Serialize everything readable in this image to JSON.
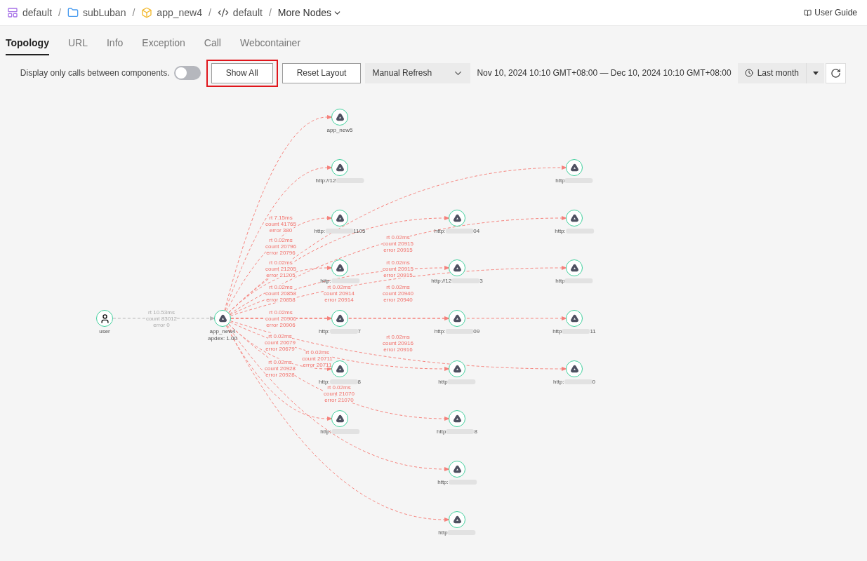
{
  "breadcrumb": {
    "items": [
      {
        "label": "default",
        "kind": "workspace"
      },
      {
        "label": "subLuban",
        "kind": "folder"
      },
      {
        "label": "app_new4",
        "kind": "app"
      },
      {
        "label": "default",
        "kind": "code"
      }
    ],
    "separator": "/",
    "more": "More Nodes"
  },
  "user_guide": "User Guide",
  "tabs": [
    {
      "label": "Topology",
      "selected": true
    },
    {
      "label": "URL",
      "selected": false
    },
    {
      "label": "Info",
      "selected": false
    },
    {
      "label": "Exception",
      "selected": false
    },
    {
      "label": "Call",
      "selected": false
    },
    {
      "label": "Webcontainer",
      "selected": false
    }
  ],
  "toolbar": {
    "toggle_label": "Display only calls between components.",
    "toggle_on": false,
    "show_all": {
      "label": "Show All",
      "highlighted": true
    },
    "reset_layout": "Reset Layout",
    "refresh_mode": "Manual Refresh",
    "time_range": "Nov 10, 2024 10:10 GMT+08:00 — Dec 10, 2024 10:10 GMT+08:00",
    "period": "Last month"
  },
  "graph": {
    "nodes": [
      {
        "kind": "user",
        "name": "user"
      },
      {
        "kind": "service",
        "name": "app_new4",
        "sub": "apdex: 1.00"
      },
      {
        "kind": "service",
        "name": "app_new5"
      },
      {
        "kind": "service",
        "name": "http://12",
        "masked": true
      },
      {
        "kind": "service",
        "name": "http:",
        "masked": true,
        "suffix": "1105"
      },
      {
        "kind": "service",
        "name": "http:",
        "masked": true
      },
      {
        "kind": "service",
        "name": "http:",
        "masked": true,
        "suffix": "7"
      },
      {
        "kind": "service",
        "name": "http:",
        "masked": true,
        "suffix": "8"
      },
      {
        "kind": "service",
        "name": "http:",
        "masked": true
      },
      {
        "kind": "service",
        "name": "http:",
        "masked": true,
        "suffix": "04"
      },
      {
        "kind": "service",
        "name": "http://12",
        "masked": true,
        "suffix": "3"
      },
      {
        "kind": "service",
        "name": "http:",
        "masked": true,
        "suffix": "09"
      },
      {
        "kind": "service",
        "name": "http",
        "masked": true
      },
      {
        "kind": "service",
        "name": "http",
        "masked": true,
        "suffix": "8"
      },
      {
        "kind": "service",
        "name": "http:",
        "masked": true
      },
      {
        "kind": "service",
        "name": "http",
        "masked": true
      },
      {
        "kind": "service",
        "name": "http",
        "masked": true
      },
      {
        "kind": "service",
        "name": "http:",
        "masked": true
      },
      {
        "kind": "service",
        "name": "http",
        "masked": true
      },
      {
        "kind": "service",
        "name": "http",
        "masked": true,
        "suffix": "11"
      },
      {
        "kind": "service",
        "name": "http:",
        "masked": true,
        "suffix": "0"
      }
    ],
    "edges": [
      {
        "kind": "normal"
      },
      {
        "kind": "error"
      },
      {
        "kind": "error"
      },
      {
        "kind": "error"
      },
      {
        "kind": "error"
      },
      {
        "kind": "error"
      },
      {
        "kind": "error"
      },
      {
        "kind": "error"
      },
      {
        "kind": "error"
      },
      {
        "kind": "error"
      },
      {
        "kind": "error"
      },
      {
        "kind": "error"
      },
      {
        "kind": "error"
      },
      {
        "kind": "error"
      },
      {
        "kind": "error"
      },
      {
        "kind": "error"
      },
      {
        "kind": "error"
      },
      {
        "kind": "error"
      },
      {
        "kind": "error"
      },
      {
        "kind": "error"
      }
    ],
    "edge_labels": [
      {
        "kind": "normal",
        "rt": "rt 10.53ms",
        "count": "count 83012",
        "error": "error 0"
      },
      {
        "kind": "error",
        "rt": "rt 7.15ms",
        "count": "count 41765",
        "error": "error 380"
      },
      {
        "kind": "error",
        "rt": "rt 0.02ms",
        "count": "count 20796",
        "error": "error 20796"
      },
      {
        "kind": "error",
        "rt": "rt 0.02ms",
        "count": "count 21205",
        "error": "error 21205"
      },
      {
        "kind": "error",
        "rt": "rt 0.02ms",
        "count": "count 20858",
        "error": "error 20858"
      },
      {
        "kind": "error",
        "rt": "rt 0.02ms",
        "count": "count 20906",
        "error": "error 20906"
      },
      {
        "kind": "error",
        "rt": "rt 0.02ms",
        "count": "count 20679",
        "error": "error 20679"
      },
      {
        "kind": "error",
        "rt": "rt 0.02ms",
        "count": "count 20711",
        "error": "error 20711"
      },
      {
        "kind": "error",
        "rt": "rt 0.02ms",
        "count": "count 20928",
        "error": "error 20928"
      },
      {
        "kind": "error",
        "rt": "rt 0.02ms",
        "count": "count 20914",
        "error": "error 20914"
      },
      {
        "kind": "error",
        "rt": "rt 0.02ms",
        "count": "count 21070",
        "error": "error 21070"
      },
      {
        "kind": "error",
        "rt": "rt 0.02ms",
        "count": "count 20915",
        "error": "error 20915"
      },
      {
        "kind": "error",
        "rt": "rt 0.02ms",
        "count": "count 20915",
        "error": "error 20915"
      },
      {
        "kind": "error",
        "rt": "rt 0.02ms",
        "count": "count 20940",
        "error": "error 20940"
      },
      {
        "kind": "error",
        "rt": "rt 0.02ms",
        "count": "count 20916",
        "error": "error 20916"
      }
    ]
  }
}
